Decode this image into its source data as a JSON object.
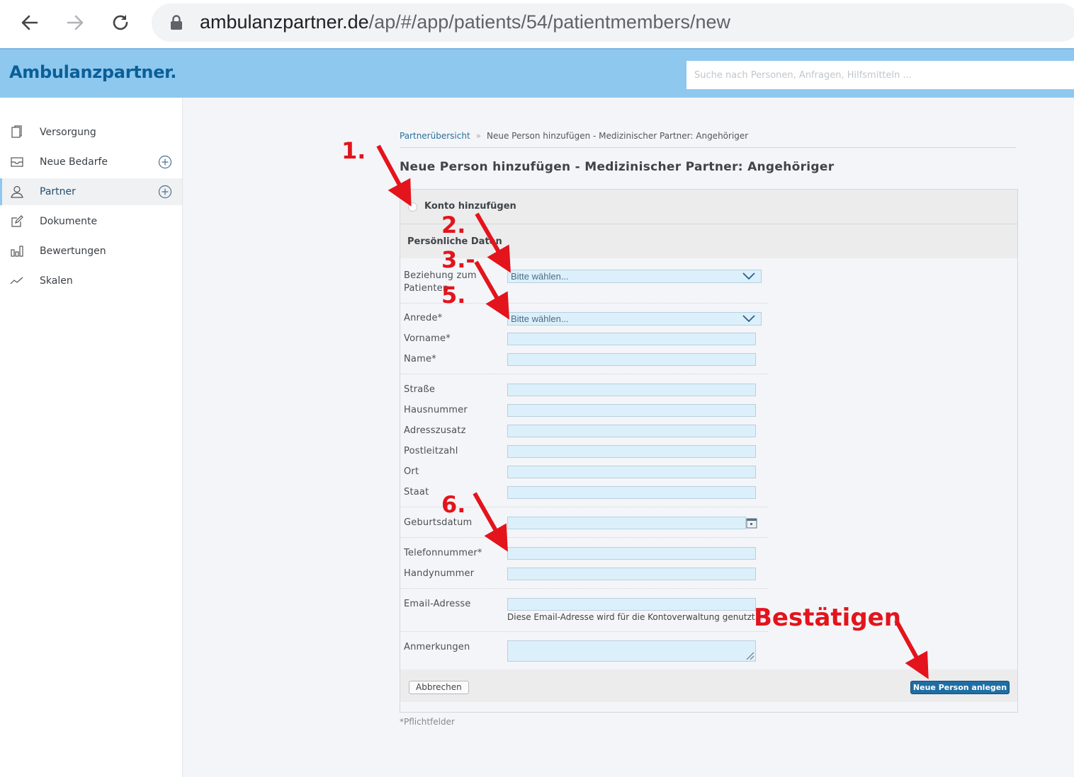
{
  "browser": {
    "url_host": "ambulanzpartner.de",
    "url_path": "/ap/#/app/patients/54/patientmembers/new"
  },
  "header": {
    "brand": "Ambulanzpartner.",
    "search_placeholder": "Suche nach Personen, Anfragen, Hilfsmitteln ..."
  },
  "sidebar": {
    "items": [
      {
        "label": "Versorgung",
        "icon": "clipboard-icon"
      },
      {
        "label": "Neue Bedarfe",
        "icon": "inbox-icon"
      },
      {
        "label": "Partner",
        "icon": "user-icon"
      },
      {
        "label": "Dokumente",
        "icon": "edit-icon"
      },
      {
        "label": "Bewertungen",
        "icon": "bar-chart-icon"
      },
      {
        "label": "Skalen",
        "icon": "trend-line-icon"
      }
    ]
  },
  "breadcrumb": {
    "link": "Partnerübersicht",
    "separator": "»",
    "current": "Neue Person hinzufügen - Medizinischer Partner: Angehöriger"
  },
  "page_title": "Neue Person hinzufügen - Medizinischer Partner: Angehöriger",
  "form": {
    "konto_label": "Konto hinzufügen",
    "section_label": "Persönliche Daten",
    "beziehung_label": "Beziehung zum Patienten",
    "beziehung_value": "Bitte wählen...",
    "anrede_label": "Anrede*",
    "anrede_value": "Bitte wählen...",
    "vorname_label": "Vorname*",
    "name_label": "Name*",
    "strasse_label": "Straße",
    "hausnummer_label": "Hausnummer",
    "adresszusatz_label": "Adresszusatz",
    "plz_label": "Postleitzahl",
    "ort_label": "Ort",
    "staat_label": "Staat",
    "geburtsdatum_label": "Geburtsdatum",
    "telefon_label": "Telefonnummer*",
    "handy_label": "Handynummer",
    "email_label": "Email-Adresse",
    "email_hint": "Diese Email-Adresse wird für die Kontoverwaltung genutzt.",
    "anmerkungen_label": "Anmerkungen",
    "cancel_label": "Abbrechen",
    "submit_label": "Neue Person anlegen",
    "required_note": "*Pflichtfelder"
  },
  "annotations": {
    "a1": "1.",
    "a2": "2.",
    "a3": "3.-",
    "a5": "5.",
    "a6": "6.",
    "confirm": "Bestätigen",
    "color": "#e3141c"
  },
  "colors": {
    "header_bg": "#8ec8ef",
    "brand": "#0b5f97",
    "input_bg": "#dcf0fb",
    "primary_button": "#1f6ea3"
  }
}
